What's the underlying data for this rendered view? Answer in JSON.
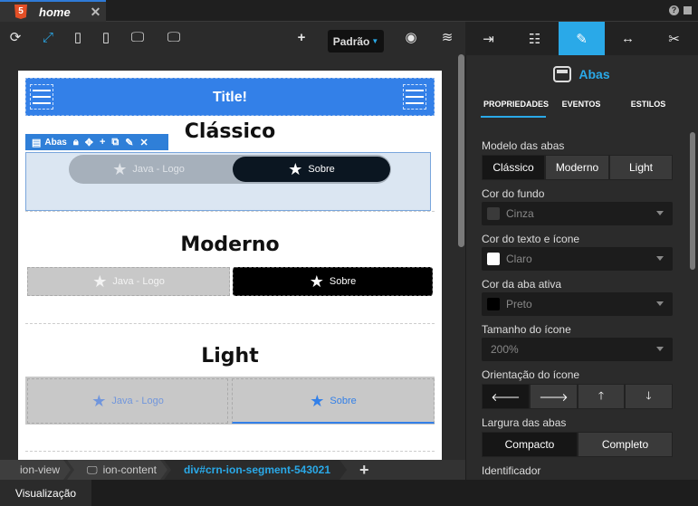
{
  "tab": {
    "icon": "html5-icon",
    "title": "home",
    "close": "✕"
  },
  "toolbar": {
    "mode_label": "Padrão"
  },
  "device": {
    "header_title": "Title!",
    "sections": [
      "Clássico",
      "Moderno",
      "Light"
    ],
    "selected_label": "Abas",
    "segments": [
      {
        "tab1": "Java - Logo",
        "tab2": "Sobre"
      },
      {
        "tab1": "Java - Logo",
        "tab2": "Sobre"
      },
      {
        "tab1": "Java - Logo",
        "tab2": "Sobre"
      }
    ]
  },
  "breadcrumb": [
    "ion-view",
    "ion-content",
    "div#crn-ion-segment-543021"
  ],
  "bottom_tab": "Visualização",
  "panel": {
    "title": "Abas",
    "tabs": [
      "PROPRIEDADES",
      "EVENTOS",
      "ESTILOS"
    ],
    "tab_style_label": "Modelo das abas",
    "tab_style_options": [
      "Clássico",
      "Moderno",
      "Light"
    ],
    "bg_color_label": "Cor do fundo",
    "bg_color_value": "Cinza",
    "text_color_label": "Cor do texto e ícone",
    "text_color_value": "Claro",
    "active_color_label": "Cor da aba ativa",
    "active_color_value": "Preto",
    "icon_size_label": "Tamanho do ícone",
    "icon_size_value": "200%",
    "icon_orientation_label": "Orientação do ícone",
    "tab_width_label": "Largura das abas",
    "tab_width_options": [
      "Compacto",
      "Completo"
    ],
    "identifier_label": "Identificador"
  },
  "colors": {
    "accent": "#2aa9e8",
    "header_blue": "#3380e8",
    "swatch_gray": "#3a3a3a",
    "swatch_light": "#ffffff",
    "swatch_black": "#000000"
  }
}
